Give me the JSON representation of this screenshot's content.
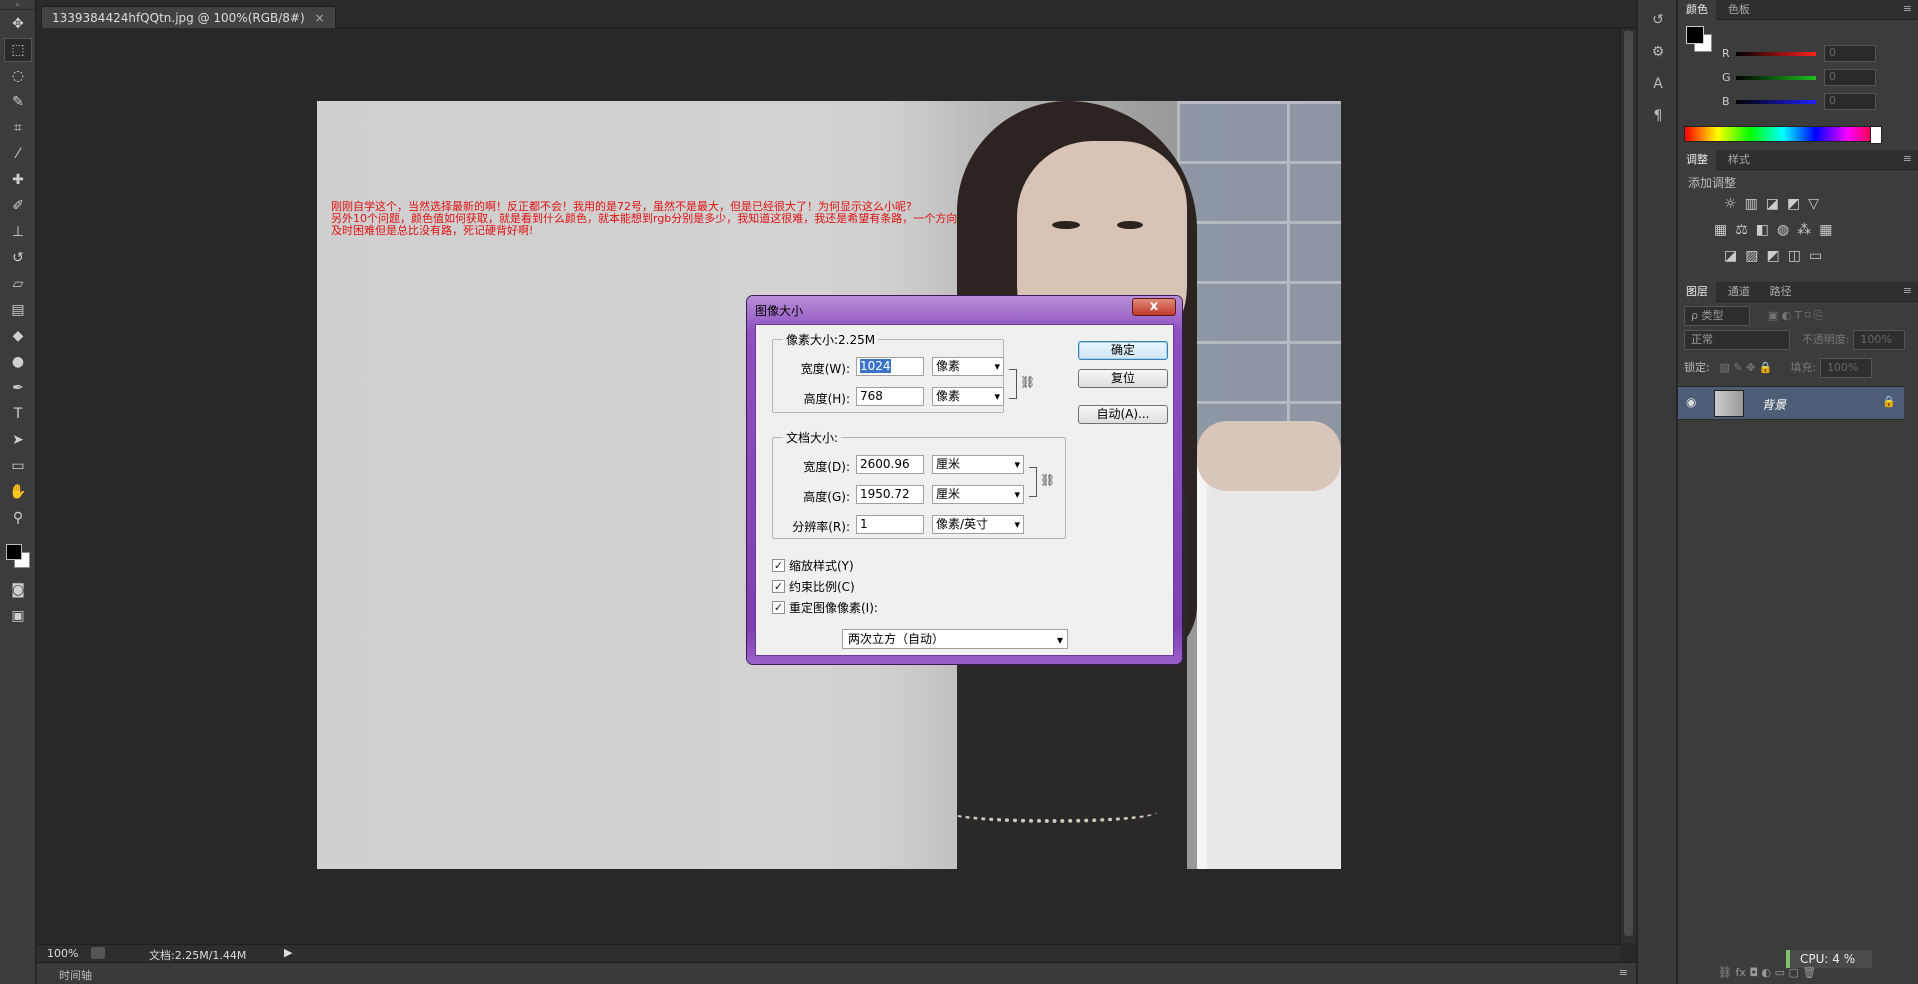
{
  "document_tab": {
    "title": "1339384424hfQQtn.jpg @ 100%(RGB/8#)",
    "close": "×"
  },
  "canvas": {
    "overlay_text": "刚刚自学这个，当然选择最新的啊！反正都不会！我用的是72号，虽然不是最大，但是已经很大了！为何显示这么小呢?\n另外10个问题，颜色值如何获取，就是看到什么颜色，就本能想到rgb分别是多少，我知道这很难，我还是希望有条路，一个方向\n及时困难但是总比没有路，死记硬背好啊!"
  },
  "statusbar": {
    "zoom": "100%",
    "doc_info": "文档:2.25M/1.44M",
    "arrow": "▶"
  },
  "timeline": {
    "label": "时间轴",
    "menu": "≡"
  },
  "panels": {
    "color": {
      "tabs": [
        "颜色",
        "色板"
      ],
      "channels": [
        {
          "label": "R",
          "value": "0",
          "color": "#ff2020"
        },
        {
          "label": "G",
          "value": "0",
          "color": "#20c020"
        },
        {
          "label": "B",
          "value": "0",
          "color": "#2020ff"
        }
      ]
    },
    "adjustments": {
      "tabs": [
        "调整",
        "样式"
      ],
      "title": "添加调整"
    },
    "layers": {
      "tabs": [
        "图层",
        "通道",
        "路径"
      ],
      "filter_kind": "ρ 类型",
      "blend_mode": "正常",
      "opacity_label": "不透明度:",
      "opacity_value": "100%",
      "lock_label": "锁定:",
      "fill_label": "填充:",
      "fill_value": "100%",
      "layer_name": "背景",
      "footer_icons": "⛓  fx  ◘  ◐  ▭  ▢  🗑"
    },
    "cpu": "CPU: 4 %"
  },
  "dialog": {
    "title": "图像大小",
    "close": "x",
    "pixel_dimensions": {
      "legend": "像素大小:2.25M",
      "width_label": "宽度(W):",
      "width_value": "1024",
      "width_unit": "像素",
      "height_label": "高度(H):",
      "height_value": "768",
      "height_unit": "像素"
    },
    "document_size": {
      "legend": "文档大小:",
      "width_label": "宽度(D):",
      "width_value": "2600.96",
      "width_unit": "厘米",
      "height_label": "高度(G):",
      "height_value": "1950.72",
      "height_unit": "厘米",
      "resolution_label": "分辨率(R):",
      "resolution_value": "1",
      "resolution_unit": "像素/英寸"
    },
    "buttons": {
      "ok": "确定",
      "reset": "复位",
      "auto": "自动(A)..."
    },
    "checkboxes": [
      {
        "label": "缩放样式(Y)",
        "checked": true
      },
      {
        "label": "约束比例(C)",
        "checked": true
      },
      {
        "label": "重定图像像素(I):",
        "checked": true
      }
    ],
    "resample_method": "两次立方（自动）"
  }
}
